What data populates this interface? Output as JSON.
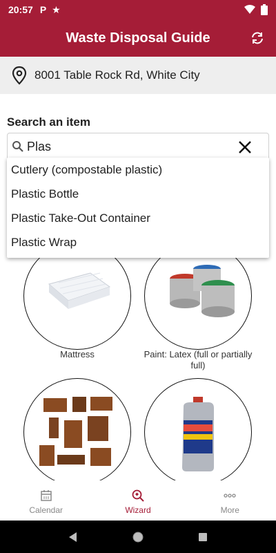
{
  "status_bar": {
    "time": "20:57",
    "icons": [
      "parking-icon",
      "star-icon",
      "wifi-icon",
      "battery-icon"
    ]
  },
  "app_bar": {
    "title": "Waste Disposal Guide"
  },
  "address": {
    "text": "8001 Table Rock Rd, White City"
  },
  "search": {
    "label": "Search an item",
    "value": "Plas"
  },
  "suggestions": [
    "Cutlery (compostable plastic)",
    "Plastic Bottle",
    "Plastic Take-Out Container",
    "Plastic Wrap"
  ],
  "items": [
    {
      "label": "Mattress"
    },
    {
      "label": "Paint: Latex (full or partially full)"
    },
    {
      "label": ""
    },
    {
      "label": ""
    }
  ],
  "bottom_nav": [
    {
      "label": "Calendar"
    },
    {
      "label": "Wizard"
    },
    {
      "label": "More"
    }
  ],
  "colors": {
    "brand": "#a51d37",
    "address_bg": "#eeeeee",
    "inactive": "#888888"
  }
}
